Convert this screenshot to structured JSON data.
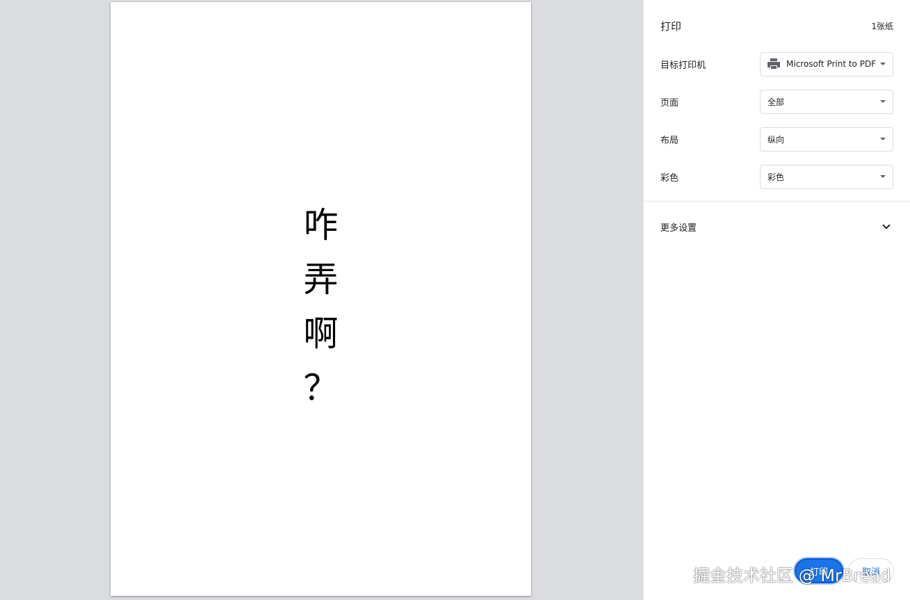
{
  "preview": {
    "page_text": [
      "咋",
      "弄",
      "啊",
      "？"
    ]
  },
  "sidebar": {
    "title": "打印",
    "sheet_count": "1张纸",
    "settings": [
      {
        "label": "目标打印机",
        "value": "Microsoft Print to PDF",
        "icon": "printer-icon"
      },
      {
        "label": "页面",
        "value": "全部"
      },
      {
        "label": "布局",
        "value": "纵向"
      },
      {
        "label": "彩色",
        "value": "彩色"
      }
    ],
    "more_settings": "更多设置",
    "print_button": "打印",
    "cancel_button": "取消"
  },
  "watermark": "掘金技术社区 @ MrBread",
  "colors": {
    "accent": "#1a73e8",
    "preview_background": "#dadce0"
  }
}
